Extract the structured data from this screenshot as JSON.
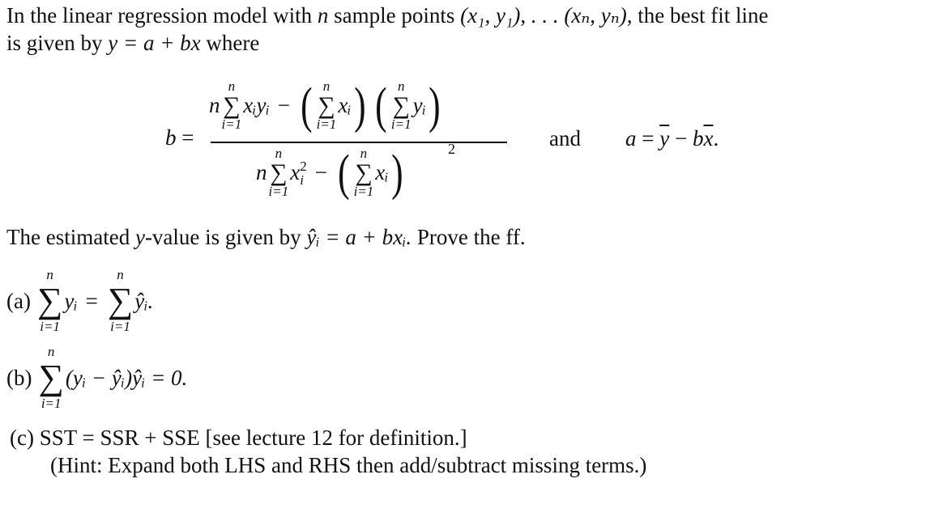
{
  "intro": {
    "line1_text": "In the linear regression model with",
    "line1_var_n": "n",
    "line1_text2": "sample points",
    "line1_points": "(x₁, y₁), . . . (xₙ, yₙ),",
    "line1_text3": "the best fit line",
    "line2_text": "is given by",
    "line2_eq": "y = a + bx",
    "line2_text2": "where"
  },
  "formula_b": {
    "lhs": "b =",
    "numerator": {
      "n": "n",
      "sum_upper": "n",
      "sum_lower": "i=1",
      "term1": "xᵢyᵢ",
      "minus": "−",
      "term2": "xᵢ",
      "term3": "yᵢ"
    },
    "denominator": {
      "n": "n",
      "sum_upper": "n",
      "sum_lower": "i=1",
      "term1": "x",
      "term1_sup": "2",
      "term1_sub": "i",
      "minus": "−",
      "term2": "xᵢ",
      "power": "2"
    },
    "sigma": "∑"
  },
  "formula_a": {
    "and": "and",
    "eq": "a = ȳ − bx̄."
  },
  "estimated": {
    "text1": "The estimated",
    "var_y": "y",
    "text2": "-value is given by",
    "eq_lhs": "ŷᵢ",
    "eq_rhs": "= a + bxᵢ.",
    "text3": "Prove the ff."
  },
  "parts": [
    {
      "label": "(a)",
      "sum_upper": "n",
      "sum_lower": "i=1",
      "lhs_term": "yᵢ",
      "equals": "=",
      "rhs_sum_upper": "n",
      "rhs_sum_lower": "i=1",
      "rhs_term": "ŷᵢ."
    },
    {
      "label": "(b)",
      "sum_upper": "n",
      "sum_lower": "i=1",
      "expr": "(yᵢ − ŷᵢ)ŷᵢ = 0."
    },
    {
      "label": "(c)",
      "expr": "SST = SSR + SSE",
      "note": "[see lecture 12 for definition.]",
      "hint": "(Hint: Expand both LHS and RHS then add/subtract missing terms.)"
    }
  ]
}
